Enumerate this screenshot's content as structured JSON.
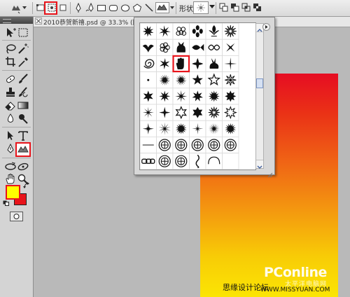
{
  "options_bar": {
    "shape_label": "形状:"
  },
  "document": {
    "tab_title": "2010恭贺新禧.psd @ 33.3% (图层"
  },
  "colors": {
    "foreground": "#ffff00",
    "background": "#e8141b",
    "highlight": "#e8141b",
    "gradient_top": "#e60d22",
    "gradient_bottom": "#fbe504"
  },
  "shape_picker": {
    "selected_shape": "starburst",
    "shapes": [
      "splat",
      "blot-star",
      "flower-cluster",
      "leaf-cluster",
      "fleur",
      "sun-rays",
      "bird",
      "flower",
      "cat",
      "fish",
      "ornament",
      "x-sparkle",
      "spiral",
      "splash",
      "hand",
      "leaf-cross",
      "rabbit",
      "star4-flare",
      "dot",
      "starburst",
      "starburst",
      "star5",
      "star5-outline",
      "star-compass",
      "star6",
      "star8",
      "star8-spike",
      "star7",
      "star12",
      "star8-bold",
      "star8-thin",
      "star4",
      "star6-outline",
      "star6-bold",
      "star12-thin",
      "star8-outline",
      "sparkle",
      "spike-burst",
      "sun-burst",
      "sparkle-thin",
      "starburst-thin",
      "sun-burst",
      "line",
      "circle-knot",
      "circle-knot",
      "circle-knot",
      "circle-knot",
      "circle-knot",
      "chain",
      "circle-knot",
      "circle-knot",
      "vertical-knot",
      "frame",
      "blank"
    ]
  },
  "watermark": {
    "brand": "PConline",
    "brand_sub": "太平洋电脑网",
    "site": "思缘设计论坛",
    "url": "WWW.MISSYUAN.COM"
  }
}
